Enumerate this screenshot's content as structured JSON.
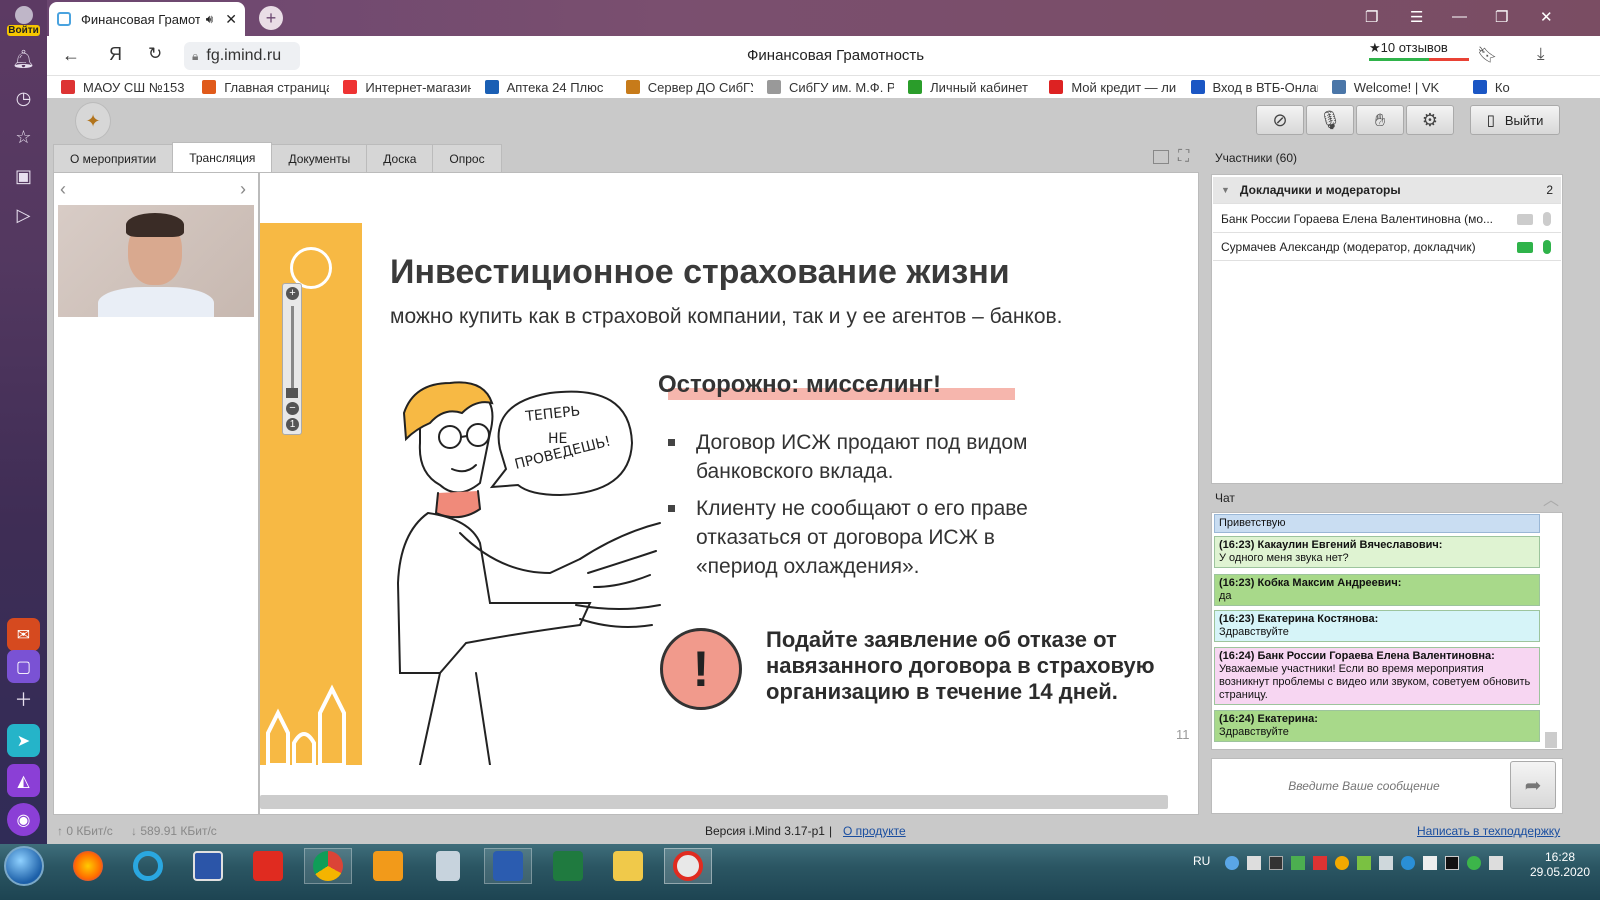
{
  "browser": {
    "login_label": "Войти",
    "tab_title": "Финансовая Грамот",
    "url": "fg.imind.ru",
    "page_title": "Финансовая Грамотность",
    "reviews": "★10 отзывов",
    "yandex_label": "Я"
  },
  "bookmarks": [
    {
      "label": "МАОУ СШ №153",
      "color": "#d33"
    },
    {
      "label": "Главная страница",
      "color": "#e05a1a"
    },
    {
      "label": "Интернет-магазин",
      "color": "#e33"
    },
    {
      "label": "Аптека 24 Плюс",
      "color": "#1a5fb4"
    },
    {
      "label": "Сервер ДО СибГУ",
      "color": "#c77b1a"
    },
    {
      "label": "СибГУ им. М.Ф. Ре",
      "color": "#999"
    },
    {
      "label": "Личный кабинет",
      "color": "#2a9d2a"
    },
    {
      "label": "Мой кредит — ли",
      "color": "#d22"
    },
    {
      "label": "Вход в ВТБ-Онлай",
      "color": "#1a56c4"
    },
    {
      "label": "Welcome! | VK",
      "color": "#4a76a8"
    },
    {
      "label": "Ко",
      "color": "#1a56c4"
    }
  ],
  "app": {
    "exit_label": "Выйти",
    "tabs": [
      "О мероприятии",
      "Трансляция",
      "Документы",
      "Доска",
      "Опрос"
    ],
    "active_tab": "Трансляция"
  },
  "slide": {
    "title": "Инвестиционное страхование жизни",
    "subtitle": "можно купить как в страховой компании, так и у ее агентов –  банков.",
    "warning": "Осторожно: мисселинг!",
    "bullets": [
      [
        "Договор ИСЖ продают под видом",
        "банковского вклада."
      ],
      [
        "Клиенту не сообщают о его праве",
        "отказаться от договора ИСЖ в",
        "«период охлаждения»."
      ]
    ],
    "bubble": [
      "ТЕПЕРЬ",
      "НЕ",
      "ПРОВЕДЕШЬ!"
    ],
    "advice": [
      "Подайте заявление об отказе от",
      "навязанного договора в страховую",
      "организацию в течение 14 дней."
    ],
    "page_number": "11"
  },
  "participants": {
    "header": "Участники (60)",
    "group_label": "Докладчики и модераторы",
    "group_count": "2",
    "rows": [
      "Банк России Гораева Елена Валентиновна (мо...",
      "Сурмачев Александр (модератор, докладчик)"
    ]
  },
  "chat": {
    "header": "Чат",
    "input_placeholder": "Введите Ваше сообщение",
    "messages": [
      {
        "author": "",
        "text": "Приветствую",
        "color": "#c9ddf2"
      },
      {
        "author": "(16:23) Какаулин Евгений Вячеславович:",
        "text": "У одного меня звука нет?",
        "color": "#dff3d2"
      },
      {
        "author": "(16:23) Кобка Максим Андреевич:",
        "text": "да",
        "color": "#a8d98a"
      },
      {
        "author": "(16:23) Екатерина Костянова:",
        "text": "Здравствуйте",
        "color": "#d6f4f8"
      },
      {
        "author": "(16:24) Банк России Гораева Елена Валентиновна:",
        "text": "Уважаемые участники! Если во время мероприятия возникнут проблемы с видео или звуком, советуем обновить страницу.",
        "color": "#f7d6f2"
      },
      {
        "author": "(16:24) Екатерина:",
        "text": "Здравствуйте",
        "color": "#a8d98a"
      }
    ]
  },
  "status": {
    "up": "0 КБит/с",
    "down": "589.91 КБит/с",
    "version": "Версия i.Mind 3.17-p1",
    "separator": "|",
    "about": "О продукте",
    "support": "Написать в техподдержку"
  },
  "taskbar": {
    "lang": "RU",
    "time": "16:28",
    "date": "29.05.2020"
  }
}
